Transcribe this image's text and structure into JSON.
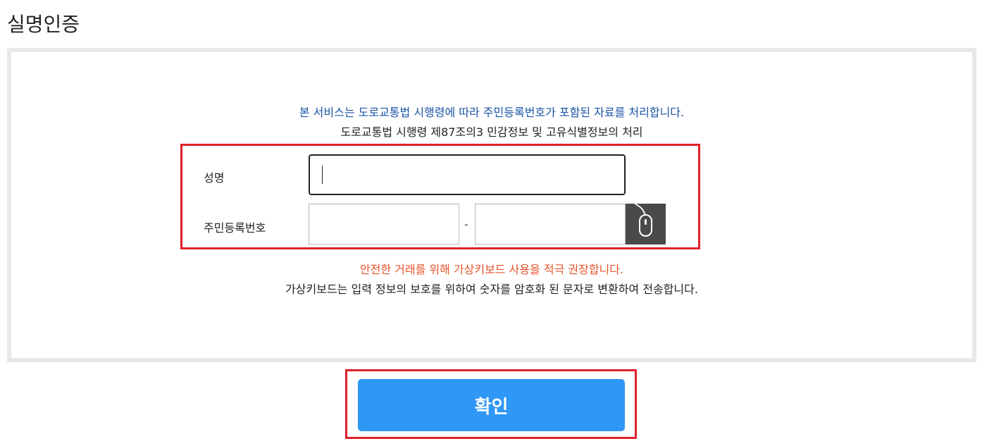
{
  "page": {
    "title": "실명인증"
  },
  "notices": {
    "service": "본 서비스는 도로교통법 시행령에 따라 주민등록번호가 포함된 자료를 처리합니다.",
    "law": "도로교통법 시행령 제87조의3 민감정보 및 고유식별정보의 처리",
    "recommend": "안전한 거래를 위해 가상키보드 사용을 적극 권장합니다.",
    "vkbd_info": "가상키보드는 입력 정보의 보호를 위하여 숫자를 암호화 된 문자로 변환하여 전송합니다."
  },
  "form": {
    "name_label": "성명",
    "name_value": "",
    "rrn_label": "주민등록번호",
    "rrn_front_value": "",
    "rrn_separator": "-",
    "rrn_back_value": "",
    "vkbd_icon": "mouse-icon"
  },
  "actions": {
    "confirm_label": "확인"
  },
  "colors": {
    "service_notice": "#1b54a6",
    "recommend_notice": "#e8532a",
    "highlight_border": "#e0202b",
    "confirm_button": "#2f97f5",
    "vkbd_button": "#4a4a4a"
  }
}
